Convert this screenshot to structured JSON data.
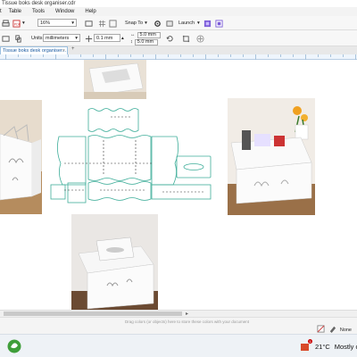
{
  "window": {
    "title": "Tissue boks desk organiser.cdr"
  },
  "menubar": {
    "items": [
      "Table",
      "Tools",
      "Window",
      "Help"
    ]
  },
  "toolbar": {
    "zoom": "16%",
    "snap_to": "Snap To",
    "launch": "Launch"
  },
  "propertybar": {
    "units_label": "Units:",
    "units_value": "millimeters",
    "nudge": "0.1 mm",
    "dup_x": "5.0 mm",
    "dup_y": "5.0 mm"
  },
  "document_tab": {
    "label": "Tissue boks desk organiser..."
  },
  "canvas": {
    "hint": "Drag colors (or objects) here to store these colors with your document"
  },
  "statusbar": {
    "fill_label": "None"
  },
  "taskbar": {
    "temperature": "21°C",
    "weather_text": "Mostly cloud",
    "notification_count": "1"
  },
  "colors": {
    "outline": "#3fae9a",
    "accent": "#1a5aa0"
  },
  "icons": [
    "pdf-icon",
    "gear-icon",
    "launch-icon",
    "undo-icon",
    "crop-icon",
    "windows-start-icon",
    "search-icon"
  ]
}
